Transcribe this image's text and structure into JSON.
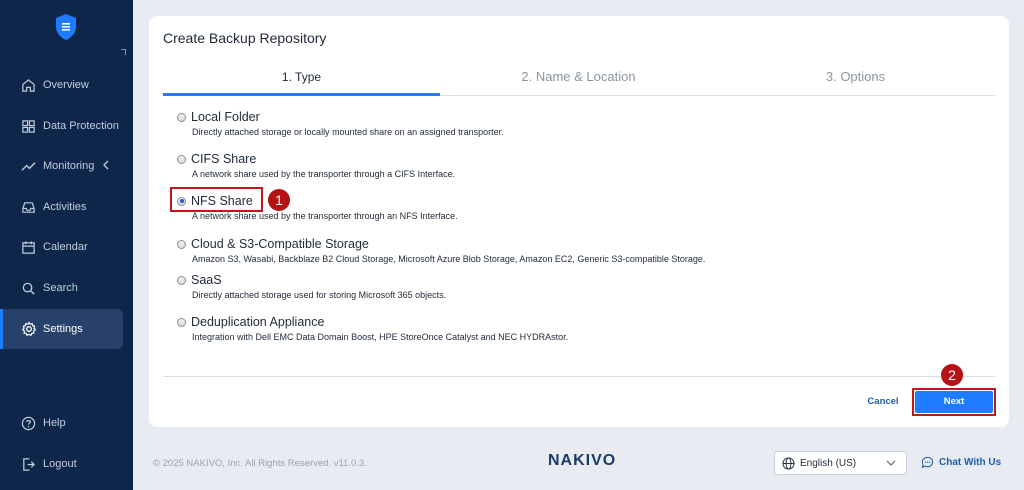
{
  "sidebar": {
    "items": [
      {
        "label": "Overview",
        "icon": "home-icon"
      },
      {
        "label": "Data Protection",
        "icon": "grid-icon"
      },
      {
        "label": "Monitoring",
        "icon": "trend-icon"
      },
      {
        "label": "Activities",
        "icon": "inbox-icon"
      },
      {
        "label": "Calendar",
        "icon": "calendar-icon"
      },
      {
        "label": "Search",
        "icon": "search-icon"
      },
      {
        "label": "Settings",
        "icon": "gear-icon",
        "active": true
      }
    ],
    "bottom_items": [
      {
        "label": "Help",
        "icon": "help-icon"
      },
      {
        "label": "Logout",
        "icon": "logout-icon"
      }
    ]
  },
  "dialog": {
    "title": "Create Backup Repository",
    "tabs": [
      {
        "label": "1. Type",
        "active": true
      },
      {
        "label": "2. Name & Location",
        "active": false
      },
      {
        "label": "3. Options",
        "active": false
      }
    ],
    "options": [
      {
        "label": "Local Folder",
        "desc": "Directly attached storage or locally mounted share on an assigned transporter.",
        "checked": false
      },
      {
        "label": "CIFS Share",
        "desc": "A network share used by the transporter through a CIFS Interface.",
        "checked": false
      },
      {
        "label": "NFS Share",
        "desc": "A network share used by the transporter through an NFS Interface.",
        "checked": true
      },
      {
        "label": "Cloud & S3-Compatible Storage",
        "desc": "Amazon S3, Wasabi, Backblaze B2 Cloud Storage, Microsoft Azure Blob Storage, Amazon EC2, Generic S3-compatible Storage.",
        "checked": false
      },
      {
        "label": "SaaS",
        "desc": "Directly attached storage used for storing Microsoft 365 objects.",
        "checked": false
      },
      {
        "label": "Deduplication Appliance",
        "desc": "Integration with Dell EMC Data Domain Boost, HPE StoreOnce Catalyst and NEC HYDRAstor.",
        "checked": false
      }
    ],
    "cancel_label": "Cancel",
    "next_label": "Next",
    "step_badges": [
      "1",
      "2"
    ]
  },
  "footer": {
    "copyright": "© 2025 NAKIVO, Inc. All Rights Reserved. v11.0.3.",
    "brand": "NAKIVO",
    "language": "English (US)",
    "chat_label": "Chat With Us"
  },
  "colors": {
    "sidebar_bg": "#0d2649",
    "accent": "#1f7bff",
    "annotation_red": "#c0161c"
  }
}
